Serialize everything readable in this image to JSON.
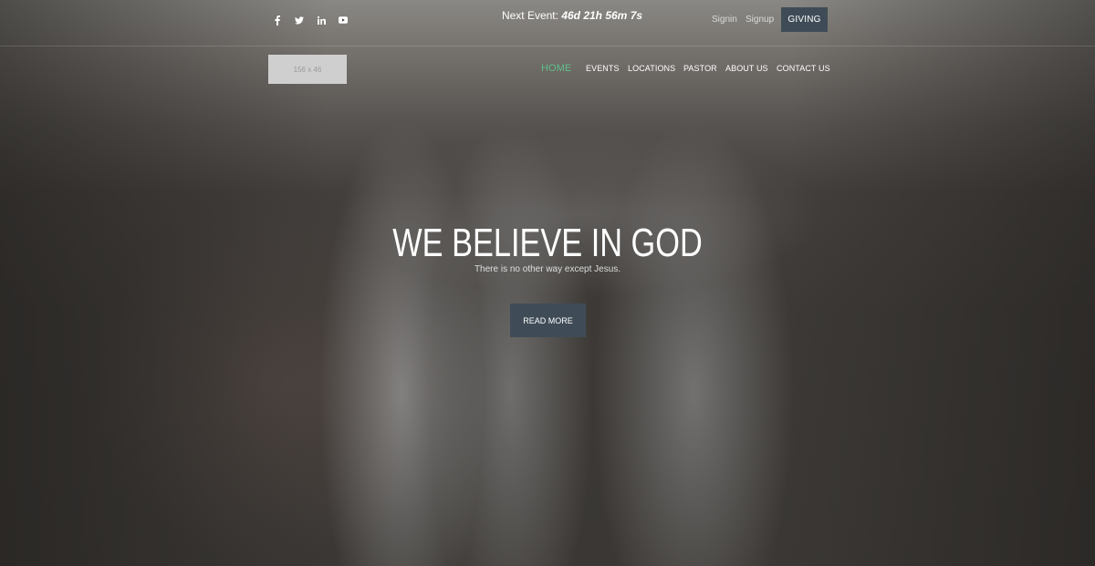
{
  "topbar": {
    "social": [
      {
        "icon": "facebook-icon"
      },
      {
        "icon": "twitter-icon"
      },
      {
        "icon": "linkedin-icon"
      },
      {
        "icon": "youtube-icon"
      }
    ],
    "next_event_label": "Next Event:",
    "countdown": "46d 21h 56m 7s",
    "signin": "Signin",
    "signup": "Signup",
    "giving": "GIVING"
  },
  "header": {
    "logo_placeholder": "156 x 46",
    "nav": [
      {
        "label": "HOME",
        "active": true
      },
      {
        "label": "EVENTS"
      },
      {
        "label": "LOCATIONS"
      },
      {
        "label": "PASTOR"
      },
      {
        "label": "ABOUT US"
      },
      {
        "label": "CONTACT US"
      }
    ]
  },
  "hero": {
    "title": "WE BELIEVE IN GOD",
    "subtitle": "There is no other way except Jesus.",
    "button": "READ MORE"
  },
  "colors": {
    "accent_active": "#5fc08a",
    "button_bg": "#3f4c57"
  }
}
